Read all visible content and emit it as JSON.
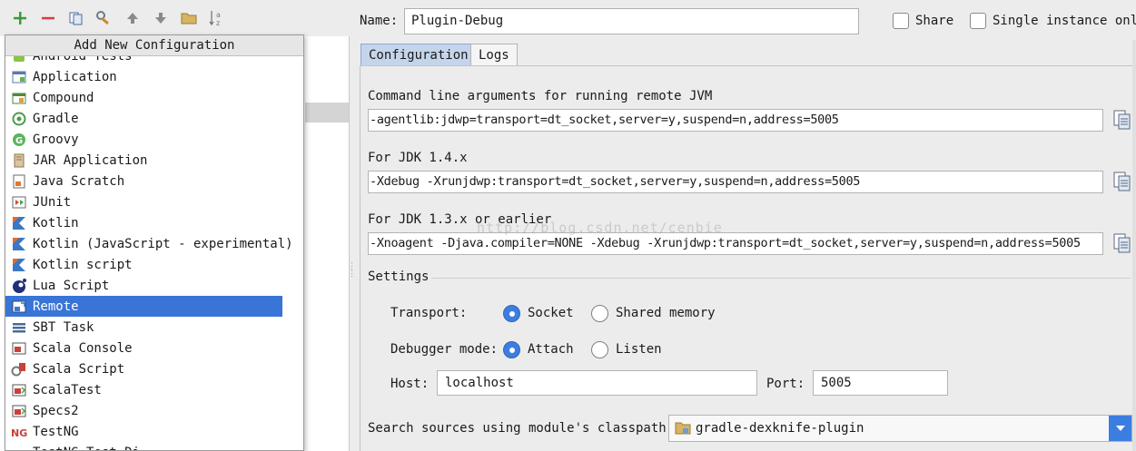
{
  "toolbar": {
    "buttons": [
      "add-icon",
      "remove-icon",
      "copy-icon",
      "edit-defaults-icon",
      "move-up-icon",
      "move-down-icon",
      "folder-icon",
      "sort-icon"
    ]
  },
  "popup": {
    "title": "Add New Configuration",
    "items": [
      {
        "label": "Android Tests",
        "icon": "android-tests-icon"
      },
      {
        "label": "Application",
        "icon": "application-icon"
      },
      {
        "label": "Compound",
        "icon": "compound-icon"
      },
      {
        "label": "Gradle",
        "icon": "gradle-icon"
      },
      {
        "label": "Groovy",
        "icon": "groovy-icon"
      },
      {
        "label": "JAR Application",
        "icon": "jar-application-icon"
      },
      {
        "label": "Java Scratch",
        "icon": "java-scratch-icon"
      },
      {
        "label": "JUnit",
        "icon": "junit-icon"
      },
      {
        "label": "Kotlin",
        "icon": "kotlin-icon"
      },
      {
        "label": "Kotlin (JavaScript - experimental)",
        "icon": "kotlin-js-icon"
      },
      {
        "label": "Kotlin script",
        "icon": "kotlin-script-icon"
      },
      {
        "label": "Lua Script",
        "icon": "lua-script-icon"
      },
      {
        "label": "Remote",
        "icon": "remote-icon",
        "selected": true
      },
      {
        "label": "SBT Task",
        "icon": "sbt-task-icon"
      },
      {
        "label": "Scala Console",
        "icon": "scala-console-icon"
      },
      {
        "label": "Scala Script",
        "icon": "scala-script-icon"
      },
      {
        "label": "ScalaTest",
        "icon": "scalatest-icon"
      },
      {
        "label": "Specs2",
        "icon": "specs2-icon"
      },
      {
        "label": "TestNG",
        "icon": "testng-icon"
      },
      {
        "label": "TestNG Test Di",
        "icon": "testng-discovery-icon"
      }
    ]
  },
  "form": {
    "name_label": "Name:",
    "name_value": "Plugin-Debug",
    "share_label": "Share",
    "single_instance_label": "Single instance only",
    "tabs": [
      "Configuration",
      "Logs"
    ],
    "cmd_label": "Command line arguments for running remote JVM",
    "cmd_value": "-agentlib:jdwp=transport=dt_socket,server=y,suspend=n,address=5005",
    "jdk14_label": "For JDK 1.4.x",
    "jdk14_value": "-Xdebug -Xrunjdwp:transport=dt_socket,server=y,suspend=n,address=5005",
    "jdk13_label": "For JDK 1.3.x or earlier",
    "jdk13_value": "-Xnoagent -Djava.compiler=NONE -Xdebug -Xrunjdwp:transport=dt_socket,server=y,suspend=n,address=5005",
    "settings_label": "Settings",
    "transport_label": "Transport:",
    "transport_socket": "Socket",
    "transport_shared": "Shared memory",
    "debugger_label": "Debugger mode:",
    "debugger_attach": "Attach",
    "debugger_listen": "Listen",
    "host_label": "Host:",
    "host_value": "localhost",
    "port_label": "Port:",
    "port_value": "5005",
    "classpath_label": "Search sources using module's classpath:",
    "classpath_value": "gradle-dexknife-plugin"
  },
  "watermark": "http://blog.csdn.net/cenbie",
  "colors": {
    "selection": "#3875d7",
    "active_tab": "#c4d5eb",
    "radio_on": "#3c7ee0",
    "add_green": "#3a9a3a",
    "remove_red": "#d04040"
  }
}
